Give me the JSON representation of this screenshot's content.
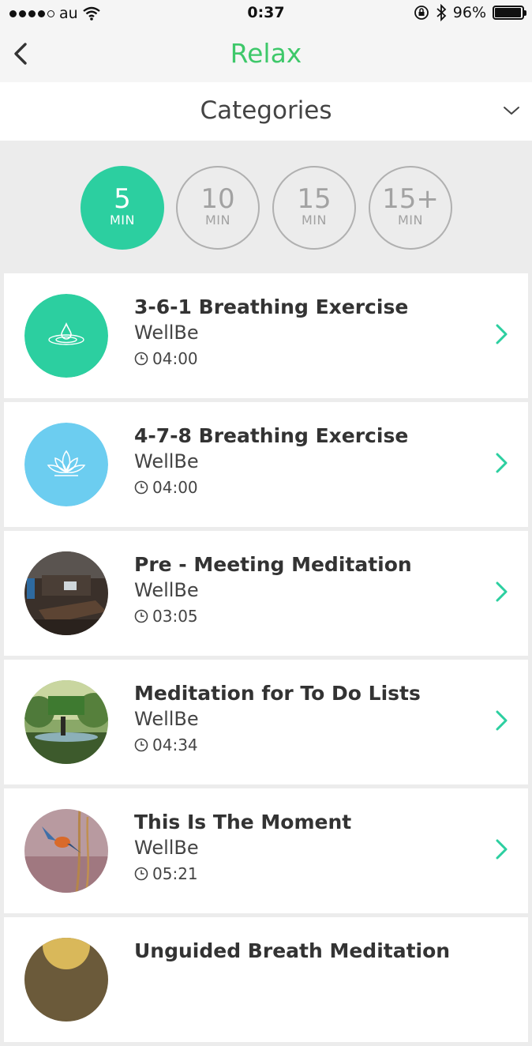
{
  "status_bar": {
    "carrier": "au",
    "time": "0:37",
    "battery": "96%",
    "battery_level": 0.96
  },
  "nav": {
    "title": "Relax",
    "back_icon": "chevron-left-icon",
    "title_color": "#3ec86a"
  },
  "categories": {
    "label": "Categories",
    "icon": "chevron-down-icon"
  },
  "durations": [
    {
      "value": "5",
      "unit": "MIN",
      "selected": true
    },
    {
      "value": "10",
      "unit": "MIN",
      "selected": false
    },
    {
      "value": "15",
      "unit": "MIN",
      "selected": false
    },
    {
      "value": "15+",
      "unit": "MIN",
      "selected": false
    }
  ],
  "accent_color": "#2ccfa0",
  "items": [
    {
      "title": "3-6-1 Breathing Exercise",
      "author": "WellBe",
      "duration": "04:00",
      "thumb": "water-drop-icon",
      "thumb_color": "#2ccfa0"
    },
    {
      "title": "4-7-8 Breathing Exercise",
      "author": "WellBe",
      "duration": "04:00",
      "thumb": "lotus-icon",
      "thumb_color": "#6ccdf0"
    },
    {
      "title": "Pre - Meeting Meditation",
      "author": "WellBe",
      "duration": "03:05",
      "thumb": "meeting-room-photo"
    },
    {
      "title": "Meditation for To Do Lists",
      "author": "WellBe",
      "duration": "04:34",
      "thumb": "forest-photo"
    },
    {
      "title": "This Is The Moment",
      "author": "WellBe",
      "duration": "05:21",
      "thumb": "bird-photo"
    },
    {
      "title": "Unguided Breath Meditation",
      "author": "",
      "duration": "",
      "thumb": "photo"
    }
  ]
}
